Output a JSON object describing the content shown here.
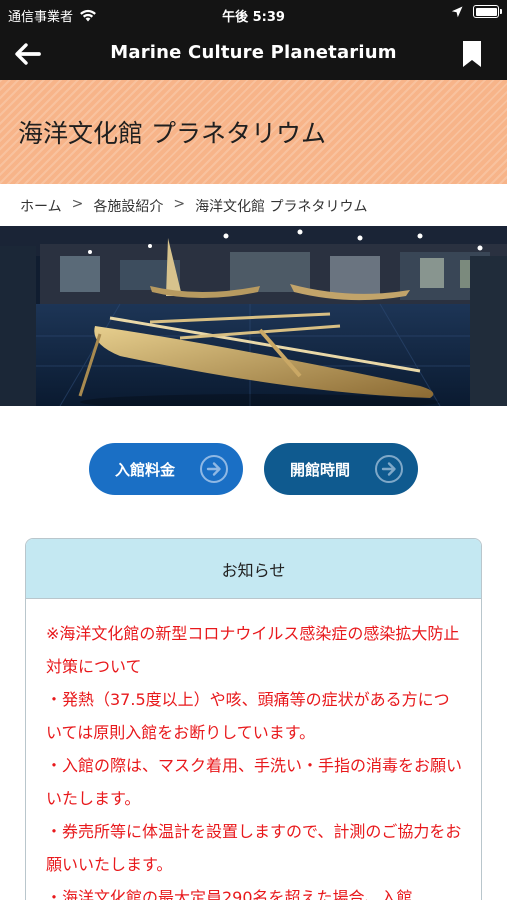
{
  "status_bar": {
    "carrier": "通信事業者",
    "time": "午後 5:39"
  },
  "nav": {
    "title": "Marine Culture Planetarium"
  },
  "page": {
    "heading": "海洋文化館 プラネタリウム"
  },
  "breadcrumb": {
    "items": [
      "ホーム",
      "各施設紹介",
      "海洋文化館 プラネタリウム"
    ],
    "separator": ">"
  },
  "hero": {
    "description": "photo"
  },
  "buttons": {
    "fee": "入館料金",
    "hours": "開館時間"
  },
  "notice": {
    "title": "お知らせ",
    "lines": [
      "※海洋文化館の新型コロナウイルス感染症の感染拡大防止対策について",
      "・発熱（37.5度以上）や咳、頭痛等の症状がある方については原則入館をお断りしています。",
      "・入館の際は、マスク着用、手洗い・手指の消毒をお願いいたします。",
      "・券売所等に体温計を設置しますので、計測のご協力をお願いいたします。",
      "・海洋文化館の最大定員290名を超えた場合、入館"
    ]
  },
  "colors": {
    "header_bg": "#f7b489",
    "nav_bg": "#141414",
    "button_fee": "#1a6fc5",
    "button_hours": "#0f5a8f",
    "notice_head": "#c4e8f2",
    "notice_text": "#e8191c"
  }
}
